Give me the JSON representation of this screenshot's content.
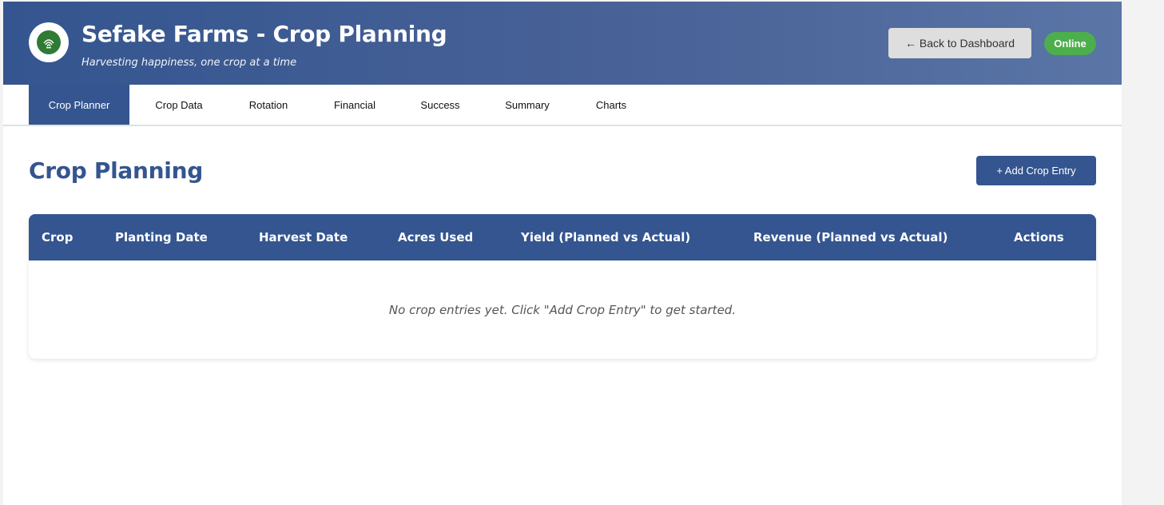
{
  "header": {
    "title": "Sefake Farms - Crop Planning",
    "tagline": "Harvesting happiness, one crop at a time",
    "back_button_label": "← Back to Dashboard",
    "status_label": "Online",
    "logo_icon": "farm-logo-icon"
  },
  "tabs": [
    {
      "label": "Crop Planner",
      "active": true
    },
    {
      "label": "Crop Data",
      "active": false
    },
    {
      "label": "Rotation",
      "active": false
    },
    {
      "label": "Financial",
      "active": false
    },
    {
      "label": "Success",
      "active": false
    },
    {
      "label": "Summary",
      "active": false
    },
    {
      "label": "Charts",
      "active": false
    }
  ],
  "main": {
    "section_title": "Crop Planning",
    "add_button_label": "+ Add Crop Entry"
  },
  "table": {
    "columns": [
      "Crop",
      "Planting Date",
      "Harvest Date",
      "Acres Used",
      "Yield (Planned vs Actual)",
      "Revenue (Planned vs Actual)",
      "Actions"
    ],
    "rows": [],
    "empty_message": "No crop entries yet. Click \"Add Crop Entry\" to get started."
  },
  "colors": {
    "primary": "#34558f",
    "status_green": "#4cae4c",
    "logo_green": "#2f7a34"
  }
}
